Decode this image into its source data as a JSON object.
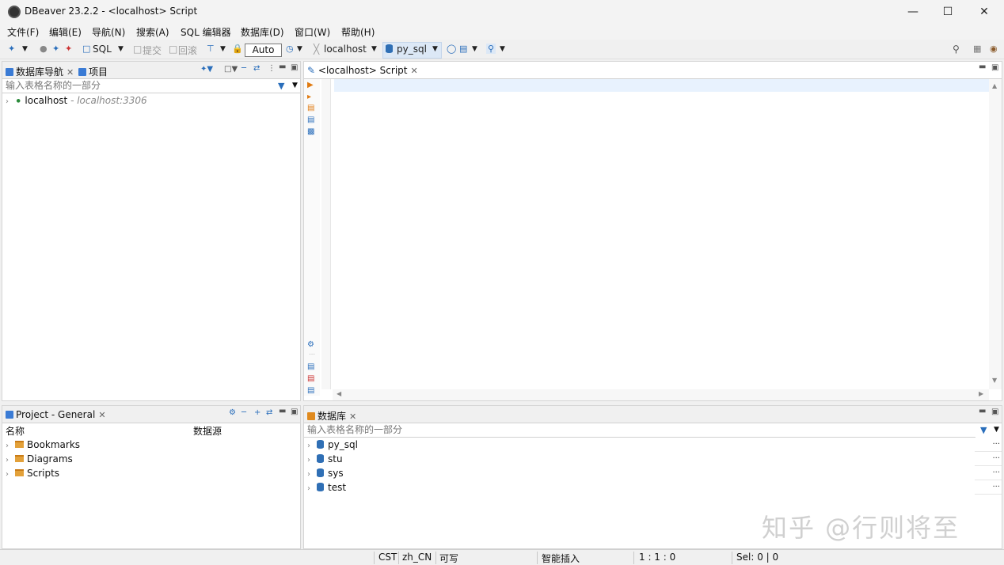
{
  "window": {
    "title": "DBeaver 23.2.2 - <localhost> Script"
  },
  "menu": [
    "文件(F)",
    "编辑(E)",
    "导航(N)",
    "搜索(A)",
    "SQL 编辑器",
    "数据库(D)",
    "窗口(W)",
    "帮助(H)"
  ],
  "toolbar": {
    "sql_label": "SQL",
    "commit_label": "提交",
    "rollback_label": "回滚",
    "auto_label": "Auto",
    "connection_label": "localhost",
    "schema_label": "py_sql"
  },
  "navigator": {
    "tab_label": "数据库导航",
    "project_tab_label": "项目",
    "filter_placeholder": "输入表格名称的一部分",
    "connections": [
      {
        "name": "localhost",
        "detail": " - localhost:3306"
      }
    ]
  },
  "editor": {
    "tab_label": "<localhost> Script"
  },
  "project": {
    "tab_label": "Project - General",
    "col_name": "名称",
    "col_source": "数据源",
    "items": [
      "Bookmarks",
      "Diagrams",
      "Scripts"
    ]
  },
  "database_panel": {
    "tab_label": "数据库",
    "filter_placeholder": "输入表格名称的一部分",
    "databases": [
      "py_sql",
      "stu",
      "sys",
      "test"
    ],
    "ellipsis": "..."
  },
  "status": {
    "timezone": "CST",
    "locale": "zh_CN",
    "writable": "可写",
    "insert_mode": "智能插入",
    "position": "1 : 1 : 0",
    "selection": "Sel: 0 | 0"
  },
  "watermark": "知乎 @行则将至",
  "colors": {
    "accent_blue": "#2f6fb5",
    "folder_orange": "#e3a13a",
    "selection_blue": "#dce8f6",
    "editor_line_highlight": "#e8f2fe"
  }
}
